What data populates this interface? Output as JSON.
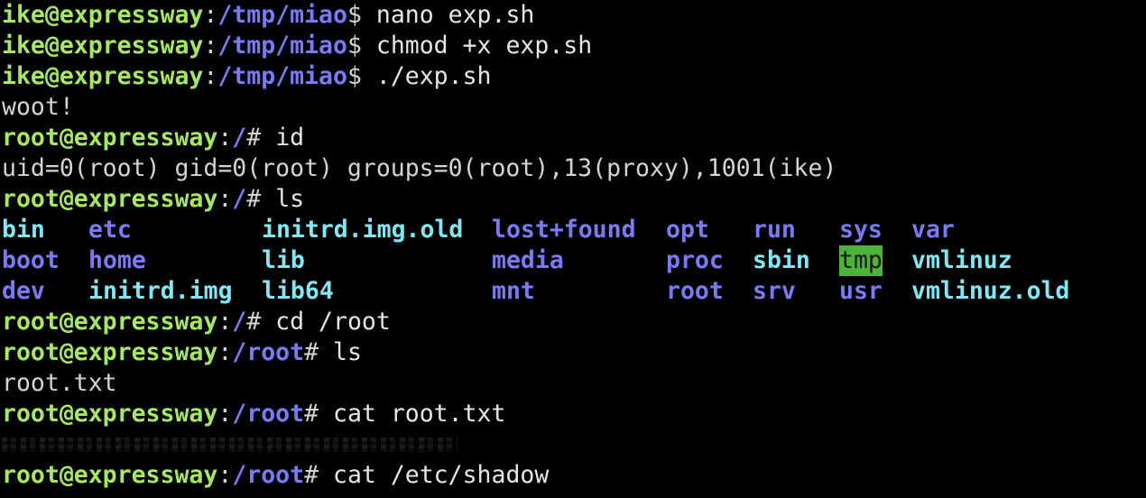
{
  "colors": {
    "background": "#000000",
    "prompt_user": "#a6e85f",
    "prompt_path": "#7a7af5",
    "text": "#d4d4d4",
    "directory": "#7a7af5",
    "symlink": "#7fe8f2",
    "sticky_dir_bg": "#4cb23a"
  },
  "lines": [
    {
      "user": "ike@expressway",
      "sep": ":",
      "path": "/tmp/miao",
      "sym": "$",
      "cmd": " nano exp.sh"
    },
    {
      "user": "ike@expressway",
      "sep": ":",
      "path": "/tmp/miao",
      "sym": "$",
      "cmd": " chmod +x exp.sh"
    },
    {
      "user": "ike@expressway",
      "sep": ":",
      "path": "/tmp/miao",
      "sym": "$",
      "cmd": " ./exp.sh"
    },
    {
      "output": "woot!"
    },
    {
      "user": "root@expressway",
      "sep": ":",
      "path": "/",
      "sym": "#",
      "cmd": " id"
    },
    {
      "output": "uid=0(root) gid=0(root) groups=0(root),13(proxy),1001(ike)"
    },
    {
      "user": "root@expressway",
      "sep": ":",
      "path": "/",
      "sym": "#",
      "cmd": " ls"
    },
    {
      "user": "root@expressway",
      "sep": ":",
      "path": "/",
      "sym": "#",
      "cmd": " cd /root"
    },
    {
      "user": "root@expressway",
      "sep": ":",
      "path": "/root",
      "sym": "#",
      "cmd": " ls"
    },
    {
      "output": "root.txt"
    },
    {
      "user": "root@expressway",
      "sep": ":",
      "path": "/root",
      "sym": "#",
      "cmd": " cat root.txt"
    },
    {
      "user": "root@expressway",
      "sep": ":",
      "path": "/root",
      "sym": "#",
      "cmd": " cat /etc/shadow"
    }
  ],
  "ls_listing": [
    [
      {
        "name": "bin",
        "kind": "link"
      },
      {
        "name": "etc",
        "kind": "dir"
      },
      {
        "name": "initrd.img.old",
        "kind": "link"
      },
      {
        "name": "lost+found",
        "kind": "dir"
      },
      {
        "name": "opt",
        "kind": "dir"
      },
      {
        "name": "run",
        "kind": "dir"
      },
      {
        "name": "sys",
        "kind": "dir"
      },
      {
        "name": "var",
        "kind": "dir"
      }
    ],
    [
      {
        "name": "boot",
        "kind": "dir"
      },
      {
        "name": "home",
        "kind": "dir"
      },
      {
        "name": "lib",
        "kind": "link"
      },
      {
        "name": "media",
        "kind": "dir"
      },
      {
        "name": "proc",
        "kind": "dir"
      },
      {
        "name": "sbin",
        "kind": "link"
      },
      {
        "name": "tmp",
        "kind": "sticky"
      },
      {
        "name": "vmlinuz",
        "kind": "link"
      }
    ],
    [
      {
        "name": "dev",
        "kind": "dir"
      },
      {
        "name": "initrd.img",
        "kind": "link"
      },
      {
        "name": "lib64",
        "kind": "link"
      },
      {
        "name": "mnt",
        "kind": "dir"
      },
      {
        "name": "root",
        "kind": "dir"
      },
      {
        "name": "srv",
        "kind": "dir"
      },
      {
        "name": "usr",
        "kind": "dir"
      },
      {
        "name": "vmlinuz.old",
        "kind": "link"
      }
    ]
  ],
  "redacted_output": {
    "icon": "pixelated-redaction"
  }
}
